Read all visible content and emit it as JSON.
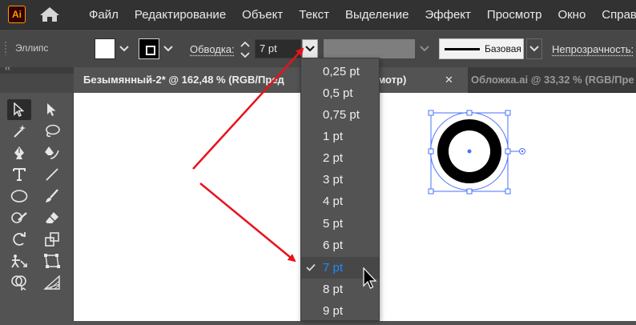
{
  "app": {
    "logo_text": "Ai"
  },
  "menu": {
    "items": [
      {
        "label": "Файл"
      },
      {
        "label": "Редактирование"
      },
      {
        "label": "Объект"
      },
      {
        "label": "Текст"
      },
      {
        "label": "Выделение"
      },
      {
        "label": "Эффект"
      },
      {
        "label": "Просмотр"
      },
      {
        "label": "Окно"
      },
      {
        "label": "Справка"
      }
    ]
  },
  "control_bar": {
    "object_type": "Эллипс",
    "fill_color": "#ffffff",
    "stroke_color": "#000000",
    "stroke_label": "Обводка:",
    "stroke_value": "7 pt",
    "profile_label": "Базовая",
    "opacity_label": "Непрозрачность:"
  },
  "tabs": [
    {
      "title": "Безымянный-2* @ 162,48 % (RGB/Пред",
      "title_tail": "просмотр)",
      "close": "✕",
      "active": true
    },
    {
      "title": "Обложка.ai @ 33,32 % (RGB/Пре",
      "active": false
    }
  ],
  "tools": {
    "icons": [
      "selection-icon",
      "direct-selection-icon",
      "magic-wand-icon",
      "lasso-icon",
      "pen-icon",
      "curvature-icon",
      "type-icon",
      "line-segment-icon",
      "ellipse-icon",
      "paintbrush-icon",
      "shaper-icon",
      "eraser-icon",
      "rotate-icon",
      "scale-icon",
      "puppet-warp-icon",
      "free-transform-icon",
      "shape-builder-icon",
      "perspective-grid-icon"
    ],
    "selected": "selection-icon"
  },
  "stroke_dropdown": {
    "options": [
      "0,25 pt",
      "0,5 pt",
      "0,75 pt",
      "1 pt",
      "2 pt",
      "3 pt",
      "4 pt",
      "5 pt",
      "6 pt",
      "7 pt",
      "8 pt",
      "9 pt"
    ],
    "selected": "7 pt"
  },
  "canvas": {
    "selected_object": "ellipse",
    "annotation_arrow_color": "#e8121a"
  }
}
